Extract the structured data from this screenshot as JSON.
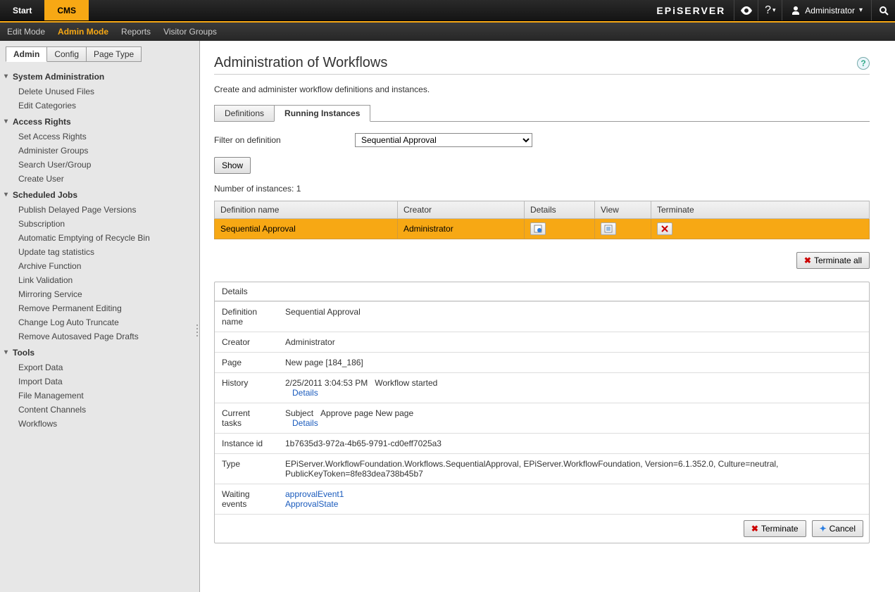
{
  "topbar": {
    "tabs": [
      "Start",
      "CMS"
    ],
    "active_tab": 1,
    "logo": "EPiSERVER",
    "user": "Administrator"
  },
  "subnav": {
    "items": [
      "Edit Mode",
      "Admin Mode",
      "Reports",
      "Visitor Groups"
    ],
    "active": 1
  },
  "sidebar": {
    "tabs": [
      "Admin",
      "Config",
      "Page Type"
    ],
    "active": 0,
    "groups": [
      {
        "title": "System Administration",
        "items": [
          "Delete Unused Files",
          "Edit Categories"
        ]
      },
      {
        "title": "Access Rights",
        "items": [
          "Set Access Rights",
          "Administer Groups",
          "Search User/Group",
          "Create User"
        ]
      },
      {
        "title": "Scheduled Jobs",
        "items": [
          "Publish Delayed Page Versions",
          "Subscription",
          "Automatic Emptying of Recycle Bin",
          "Update tag statistics",
          "Archive Function",
          "Link Validation",
          "Mirroring Service",
          "Remove Permanent Editing",
          "Change Log Auto Truncate",
          "Remove Autosaved Page Drafts"
        ]
      },
      {
        "title": "Tools",
        "items": [
          "Export Data",
          "Import Data",
          "File Management",
          "Content Channels",
          "Workflows"
        ]
      }
    ]
  },
  "main": {
    "title": "Administration of Workflows",
    "subtitle": "Create and administer workflow definitions and instances.",
    "tabs": [
      "Definitions",
      "Running Instances"
    ],
    "active_tab": 1,
    "filter_label": "Filter on definition",
    "filter_value": "Sequential Approval",
    "show_btn": "Show",
    "count_text": "Number of instances: 1",
    "table": {
      "headers": [
        "Definition name",
        "Creator",
        "Details",
        "View",
        "Terminate"
      ],
      "rows": [
        {
          "definition_name": "Sequential Approval",
          "creator": "Administrator"
        }
      ]
    },
    "terminate_all_btn": "Terminate all",
    "details": {
      "title": "Details",
      "rows": {
        "definition_name_label": "Definition name",
        "definition_name": "Sequential Approval",
        "creator_label": "Creator",
        "creator": "Administrator",
        "page_label": "Page",
        "page": "New page [184_186]",
        "history_label": "History",
        "history_time": "2/25/2011 3:04:53 PM",
        "history_event": "Workflow started",
        "history_link": "Details",
        "tasks_label": "Current tasks",
        "tasks_subject_label": "Subject",
        "tasks_subject": "Approve page New page",
        "tasks_link": "Details",
        "instance_label": "Instance id",
        "instance": "1b7635d3-972a-4b65-9791-cd0eff7025a3",
        "type_label": "Type",
        "type": "EPiServer.WorkflowFoundation.Workflows.SequentialApproval, EPiServer.WorkflowFoundation, Version=6.1.352.0, Culture=neutral, PublicKeyToken=8fe83dea738b45b7",
        "waiting_label": "Waiting events",
        "waiting_1": "approvalEvent1",
        "waiting_2": "ApprovalState"
      },
      "terminate_btn": "Terminate",
      "cancel_btn": "Cancel"
    }
  }
}
